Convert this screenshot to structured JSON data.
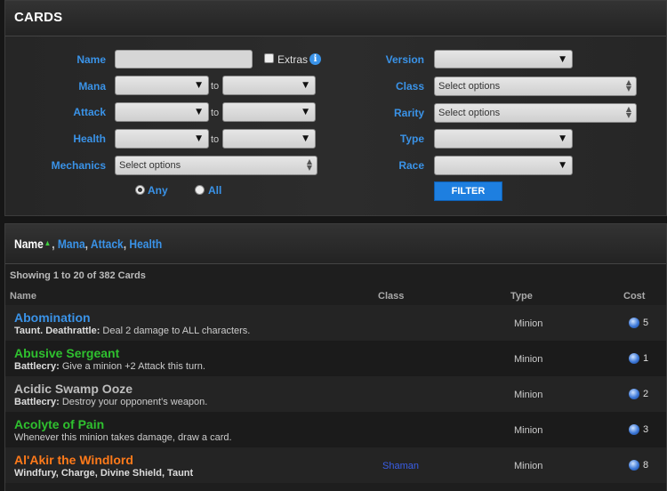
{
  "header": {
    "title": "CARDS"
  },
  "filters": {
    "name_label": "Name",
    "extras_label": "Extras",
    "info_icon": "i",
    "mana_label": "Mana",
    "attack_label": "Attack",
    "health_label": "Health",
    "mechanics_label": "Mechanics",
    "to_text": "to",
    "select_options": "Select options",
    "version_label": "Version",
    "class_label": "Class",
    "rarity_label": "Rarity",
    "type_label": "Type",
    "race_label": "Race",
    "any_label": "Any",
    "all_label": "All",
    "filter_button": "FILTER"
  },
  "sort": {
    "active": "Name",
    "sep": ",",
    "options": [
      "Mana",
      "Attack",
      "Health"
    ]
  },
  "list": {
    "showing": "Showing 1 to 20 of 382 Cards",
    "columns": {
      "name": "Name",
      "class": "Class",
      "type": "Type",
      "cost": "Cost"
    },
    "cards": [
      {
        "name": "Abomination",
        "color": "#3a93e8",
        "keyword": "Taunt. Deathrattle:",
        "text": "Deal 2 damage to ALL characters.",
        "class": "",
        "type": "Minion",
        "cost": "5"
      },
      {
        "name": "Abusive Sergeant",
        "color": "#2fc12f",
        "keyword": "Battlecry:",
        "text": "Give a minion +2 Attack this turn.",
        "class": "",
        "type": "Minion",
        "cost": "1"
      },
      {
        "name": "Acidic Swamp Ooze",
        "color": "#bdbdbd",
        "keyword": "Battlecry:",
        "text": "Destroy your opponent's weapon.",
        "class": "",
        "type": "Minion",
        "cost": "2"
      },
      {
        "name": "Acolyte of Pain",
        "color": "#2fc12f",
        "keyword": "",
        "text": "Whenever this minion takes damage, draw a card.",
        "class": "",
        "type": "Minion",
        "cost": "3"
      },
      {
        "name": "Al'Akir the Windlord",
        "color": "#ff7a1a",
        "keyword": "Windfury, Charge, Divine Shield, Taunt",
        "text": "",
        "class": "Shaman",
        "type": "Minion",
        "cost": "8"
      }
    ]
  },
  "colors": {
    "accent": "#3a93e8",
    "button": "#1e7fe0",
    "sort_caret": "#3fd13f",
    "shaman": "#3a5fe8"
  }
}
